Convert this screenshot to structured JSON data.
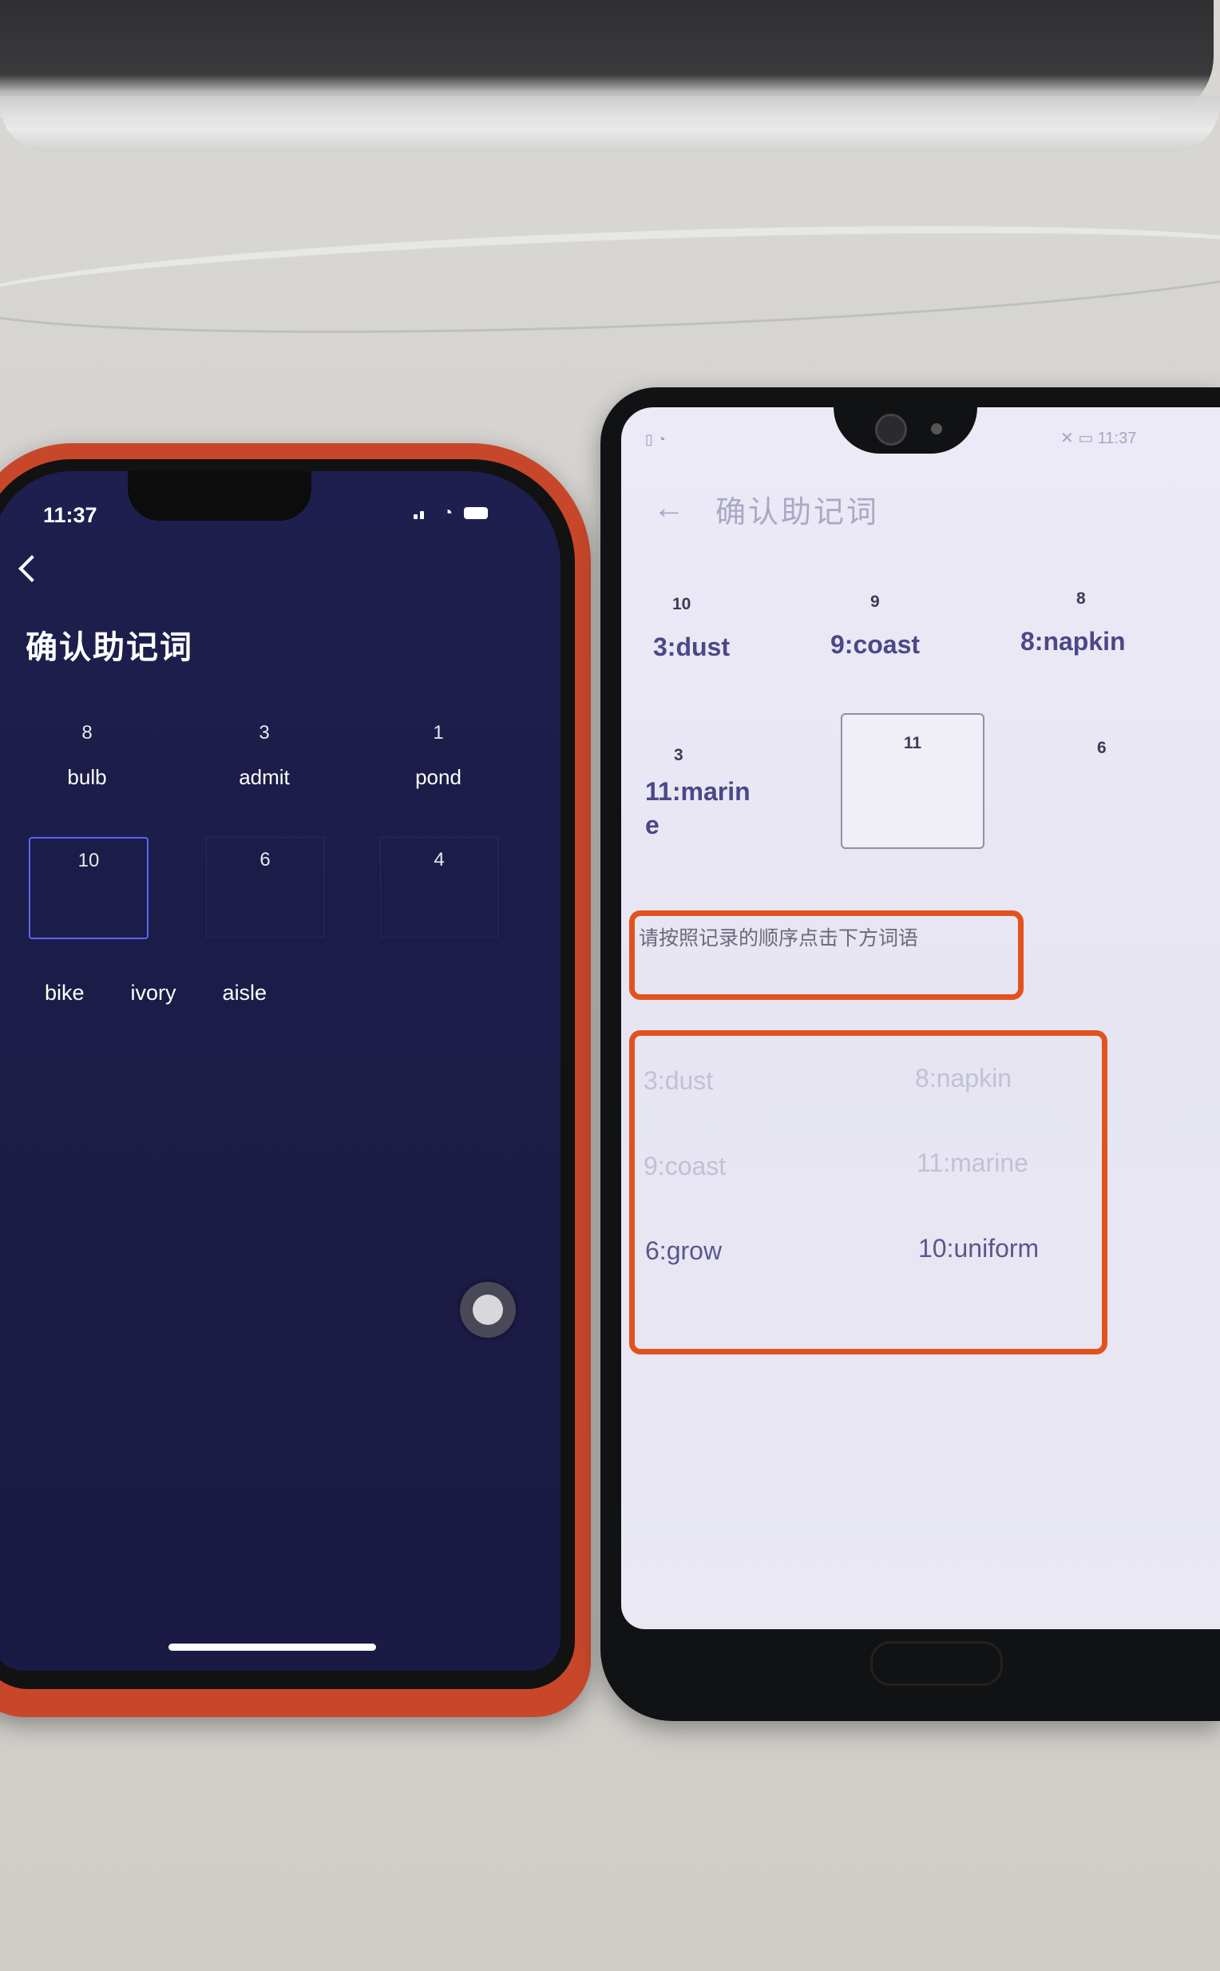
{
  "left_phone": {
    "status_time": "11:37",
    "title": "确认助记词",
    "slots": [
      {
        "num": "8",
        "word": "bulb"
      },
      {
        "num": "3",
        "word": "admit"
      },
      {
        "num": "1",
        "word": "pond"
      },
      {
        "num": "10",
        "word": ""
      },
      {
        "num": "6",
        "word": ""
      },
      {
        "num": "4",
        "word": ""
      }
    ],
    "options": [
      "bike",
      "ivory",
      "aisle"
    ]
  },
  "right_phone": {
    "status_time": "11:37",
    "title": "确认助记词",
    "back_glyph": "←",
    "slots": [
      {
        "num": "10",
        "word": "3:dust"
      },
      {
        "num": "9",
        "word": "9:coast"
      },
      {
        "num": "8",
        "word": "8:napkin"
      },
      {
        "num": "3",
        "word": "11:marin e"
      },
      {
        "num": "11",
        "word": ""
      },
      {
        "num": "6",
        "word": ""
      }
    ],
    "hint": "请按照记录的顺序点击下方词语",
    "options": [
      {
        "label": "3:dust",
        "state": "used"
      },
      {
        "label": "8:napkin",
        "state": "used"
      },
      {
        "label": "9:coast",
        "state": "used"
      },
      {
        "label": "11:marine",
        "state": "used"
      },
      {
        "label": "6:grow",
        "state": "available"
      },
      {
        "label": "10:uniform",
        "state": "available"
      }
    ]
  },
  "colors": {
    "annotation_red": "#e2521f",
    "ios_accent": "#5b63ff",
    "android_text": "#4c4788"
  }
}
